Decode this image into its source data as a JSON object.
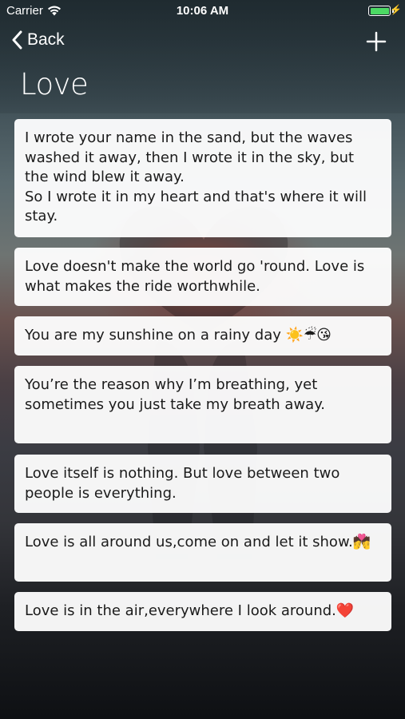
{
  "status_bar": {
    "carrier": "Carrier",
    "time": "10:06 AM",
    "battery_level_percent": 100,
    "battery_color": "#4cd964"
  },
  "nav": {
    "back_label": "Back",
    "back_icon": "chevron-left-icon",
    "add_icon": "plus-icon"
  },
  "page": {
    "title": "Love"
  },
  "quotes": [
    "I wrote your name in the sand, but the waves washed it away, then I wrote it in the sky, but the wind blew it away.\nSo I wrote it in my heart and that's where it will stay.",
    "Love doesn't make the world go 'round. Love is what makes the ride worthwhile.",
    "You are my sunshine on a rainy day ☀️☔😘",
    "You’re the reason why I’m breathing, yet sometimes you just take my breath away.",
    "Love itself is nothing. But love between two people is everything.",
    "Love is all around us,come on and let it show.💏",
    "Love is in the air,everywhere I look around.❤️"
  ]
}
